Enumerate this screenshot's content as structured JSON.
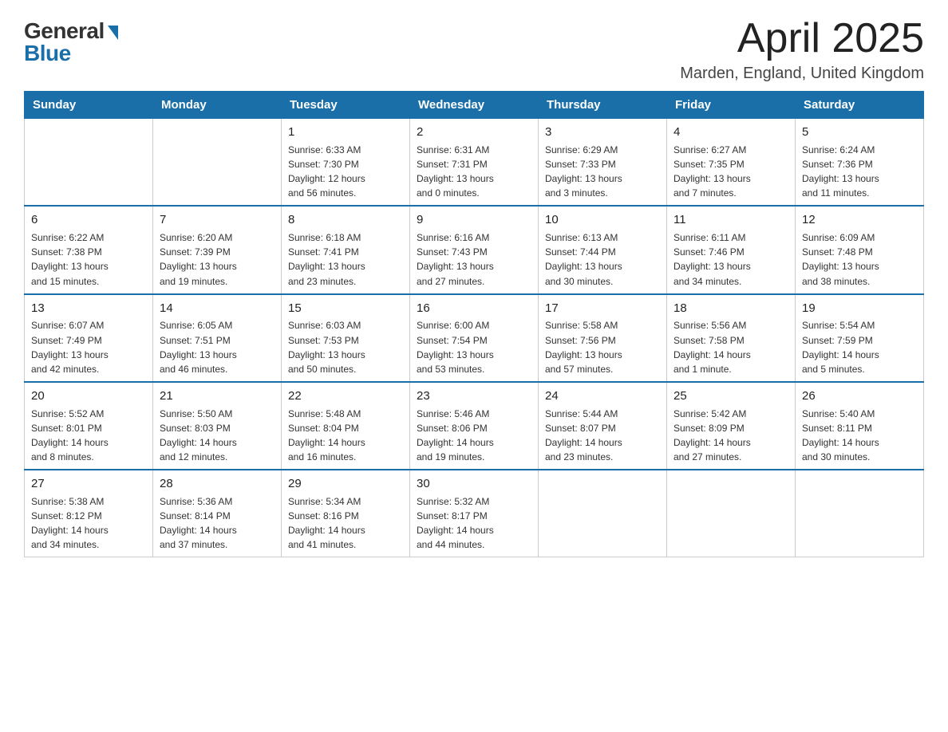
{
  "logo": {
    "general": "General",
    "blue": "Blue",
    "triangle": "▶"
  },
  "title": "April 2025",
  "subtitle": "Marden, England, United Kingdom",
  "days_of_week": [
    "Sunday",
    "Monday",
    "Tuesday",
    "Wednesday",
    "Thursday",
    "Friday",
    "Saturday"
  ],
  "weeks": [
    [
      {
        "day": "",
        "info": ""
      },
      {
        "day": "",
        "info": ""
      },
      {
        "day": "1",
        "info": "Sunrise: 6:33 AM\nSunset: 7:30 PM\nDaylight: 12 hours\nand 56 minutes."
      },
      {
        "day": "2",
        "info": "Sunrise: 6:31 AM\nSunset: 7:31 PM\nDaylight: 13 hours\nand 0 minutes."
      },
      {
        "day": "3",
        "info": "Sunrise: 6:29 AM\nSunset: 7:33 PM\nDaylight: 13 hours\nand 3 minutes."
      },
      {
        "day": "4",
        "info": "Sunrise: 6:27 AM\nSunset: 7:35 PM\nDaylight: 13 hours\nand 7 minutes."
      },
      {
        "day": "5",
        "info": "Sunrise: 6:24 AM\nSunset: 7:36 PM\nDaylight: 13 hours\nand 11 minutes."
      }
    ],
    [
      {
        "day": "6",
        "info": "Sunrise: 6:22 AM\nSunset: 7:38 PM\nDaylight: 13 hours\nand 15 minutes."
      },
      {
        "day": "7",
        "info": "Sunrise: 6:20 AM\nSunset: 7:39 PM\nDaylight: 13 hours\nand 19 minutes."
      },
      {
        "day": "8",
        "info": "Sunrise: 6:18 AM\nSunset: 7:41 PM\nDaylight: 13 hours\nand 23 minutes."
      },
      {
        "day": "9",
        "info": "Sunrise: 6:16 AM\nSunset: 7:43 PM\nDaylight: 13 hours\nand 27 minutes."
      },
      {
        "day": "10",
        "info": "Sunrise: 6:13 AM\nSunset: 7:44 PM\nDaylight: 13 hours\nand 30 minutes."
      },
      {
        "day": "11",
        "info": "Sunrise: 6:11 AM\nSunset: 7:46 PM\nDaylight: 13 hours\nand 34 minutes."
      },
      {
        "day": "12",
        "info": "Sunrise: 6:09 AM\nSunset: 7:48 PM\nDaylight: 13 hours\nand 38 minutes."
      }
    ],
    [
      {
        "day": "13",
        "info": "Sunrise: 6:07 AM\nSunset: 7:49 PM\nDaylight: 13 hours\nand 42 minutes."
      },
      {
        "day": "14",
        "info": "Sunrise: 6:05 AM\nSunset: 7:51 PM\nDaylight: 13 hours\nand 46 minutes."
      },
      {
        "day": "15",
        "info": "Sunrise: 6:03 AM\nSunset: 7:53 PM\nDaylight: 13 hours\nand 50 minutes."
      },
      {
        "day": "16",
        "info": "Sunrise: 6:00 AM\nSunset: 7:54 PM\nDaylight: 13 hours\nand 53 minutes."
      },
      {
        "day": "17",
        "info": "Sunrise: 5:58 AM\nSunset: 7:56 PM\nDaylight: 13 hours\nand 57 minutes."
      },
      {
        "day": "18",
        "info": "Sunrise: 5:56 AM\nSunset: 7:58 PM\nDaylight: 14 hours\nand 1 minute."
      },
      {
        "day": "19",
        "info": "Sunrise: 5:54 AM\nSunset: 7:59 PM\nDaylight: 14 hours\nand 5 minutes."
      }
    ],
    [
      {
        "day": "20",
        "info": "Sunrise: 5:52 AM\nSunset: 8:01 PM\nDaylight: 14 hours\nand 8 minutes."
      },
      {
        "day": "21",
        "info": "Sunrise: 5:50 AM\nSunset: 8:03 PM\nDaylight: 14 hours\nand 12 minutes."
      },
      {
        "day": "22",
        "info": "Sunrise: 5:48 AM\nSunset: 8:04 PM\nDaylight: 14 hours\nand 16 minutes."
      },
      {
        "day": "23",
        "info": "Sunrise: 5:46 AM\nSunset: 8:06 PM\nDaylight: 14 hours\nand 19 minutes."
      },
      {
        "day": "24",
        "info": "Sunrise: 5:44 AM\nSunset: 8:07 PM\nDaylight: 14 hours\nand 23 minutes."
      },
      {
        "day": "25",
        "info": "Sunrise: 5:42 AM\nSunset: 8:09 PM\nDaylight: 14 hours\nand 27 minutes."
      },
      {
        "day": "26",
        "info": "Sunrise: 5:40 AM\nSunset: 8:11 PM\nDaylight: 14 hours\nand 30 minutes."
      }
    ],
    [
      {
        "day": "27",
        "info": "Sunrise: 5:38 AM\nSunset: 8:12 PM\nDaylight: 14 hours\nand 34 minutes."
      },
      {
        "day": "28",
        "info": "Sunrise: 5:36 AM\nSunset: 8:14 PM\nDaylight: 14 hours\nand 37 minutes."
      },
      {
        "day": "29",
        "info": "Sunrise: 5:34 AM\nSunset: 8:16 PM\nDaylight: 14 hours\nand 41 minutes."
      },
      {
        "day": "30",
        "info": "Sunrise: 5:32 AM\nSunset: 8:17 PM\nDaylight: 14 hours\nand 44 minutes."
      },
      {
        "day": "",
        "info": ""
      },
      {
        "day": "",
        "info": ""
      },
      {
        "day": "",
        "info": ""
      }
    ]
  ]
}
